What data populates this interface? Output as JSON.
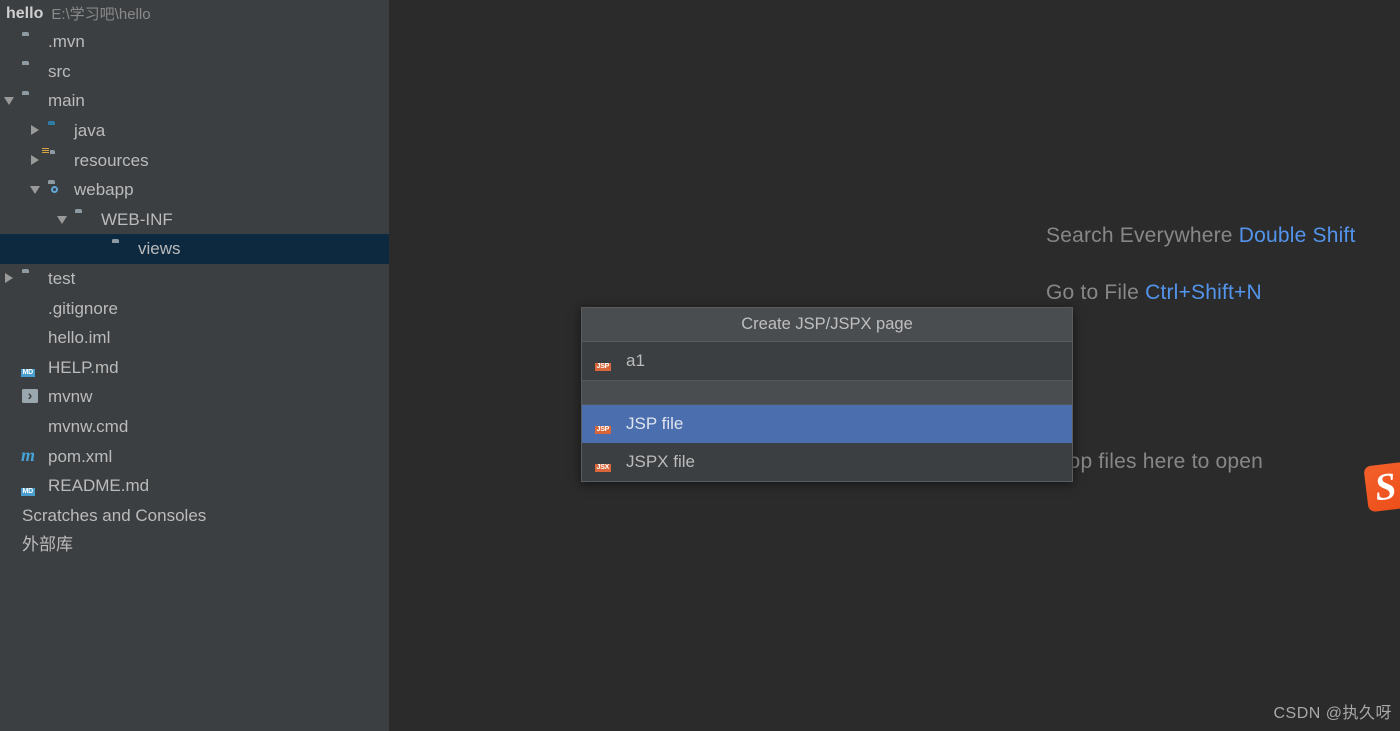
{
  "project": {
    "name": "hello",
    "path": "E:\\学习吧\\hello"
  },
  "tree": {
    "items": [
      {
        "label": ".mvn",
        "icon": "folder-icon",
        "arrow": "none",
        "indent": 4,
        "selected": false
      },
      {
        "label": "src",
        "icon": "folder-icon",
        "arrow": "none",
        "indent": 4,
        "selected": false
      },
      {
        "label": "main",
        "icon": "folder-icon",
        "arrow": "expanded",
        "indent": 4,
        "selected": false
      },
      {
        "label": "java",
        "icon": "folder-source-icon",
        "arrow": "collapsed",
        "indent": 30,
        "selected": false
      },
      {
        "label": "resources",
        "icon": "folder-resources-icon",
        "arrow": "collapsed",
        "indent": 30,
        "selected": false
      },
      {
        "label": "webapp",
        "icon": "folder-web-icon",
        "arrow": "expanded",
        "indent": 30,
        "selected": false
      },
      {
        "label": "WEB-INF",
        "icon": "folder-icon",
        "arrow": "expanded",
        "indent": 57,
        "selected": false
      },
      {
        "label": "views",
        "icon": "folder-icon",
        "arrow": "none",
        "indent": 94,
        "selected": true
      },
      {
        "label": "test",
        "icon": "folder-icon",
        "arrow": "collapsed",
        "indent": 4,
        "selected": false
      },
      {
        "label": ".gitignore",
        "icon": "gitignore-file-icon",
        "arrow": "none",
        "indent": 4,
        "selected": false
      },
      {
        "label": "hello.iml",
        "icon": "iml-file-icon",
        "arrow": "none",
        "indent": 4,
        "selected": false
      },
      {
        "label": "HELP.md",
        "icon": "markdown-file-icon",
        "arrow": "none",
        "indent": 4,
        "selected": false
      },
      {
        "label": "mvnw",
        "icon": "terminal-file-icon",
        "arrow": "none",
        "indent": 4,
        "selected": false
      },
      {
        "label": "mvnw.cmd",
        "icon": "script-file-icon",
        "arrow": "none",
        "indent": 4,
        "selected": false
      },
      {
        "label": "pom.xml",
        "icon": "maven-file-icon",
        "arrow": "none",
        "indent": 4,
        "selected": false
      },
      {
        "label": "README.md",
        "icon": "markdown-file-icon",
        "arrow": "none",
        "indent": 4,
        "selected": false
      },
      {
        "label": "Scratches and Consoles",
        "icon": "none",
        "arrow": "none",
        "indent": 4,
        "selected": false
      },
      {
        "label": "外部库",
        "icon": "none",
        "arrow": "none",
        "indent": 4,
        "selected": false
      }
    ]
  },
  "editor": {
    "hints": [
      {
        "action": "Search Everywhere",
        "shortcut": "Double Shift"
      },
      {
        "action": "Go to File",
        "shortcut": "Ctrl+Shift+N"
      }
    ],
    "drop_hint": "Drop files here to open"
  },
  "popup": {
    "title": "Create JSP/JSPX page",
    "input_value": "a1",
    "options": [
      {
        "label": "JSP file",
        "badge": "JSP",
        "selected": true
      },
      {
        "label": "JSPX file",
        "badge": "JSX",
        "selected": false
      }
    ]
  },
  "watermark": "CSDN @执久呀",
  "colors": {
    "sidebar_bg": "#3c3f41",
    "editor_bg": "#2b2b2b",
    "tree_selection": "#0d293f",
    "popup_selection": "#4b6eaf",
    "shortcut_link": "#5394ec",
    "jsp_badge": "#d8663a",
    "md_badge": "#4a9ece",
    "maven_blue": "#45a3d6",
    "sogou_orange": "#ee501d"
  }
}
